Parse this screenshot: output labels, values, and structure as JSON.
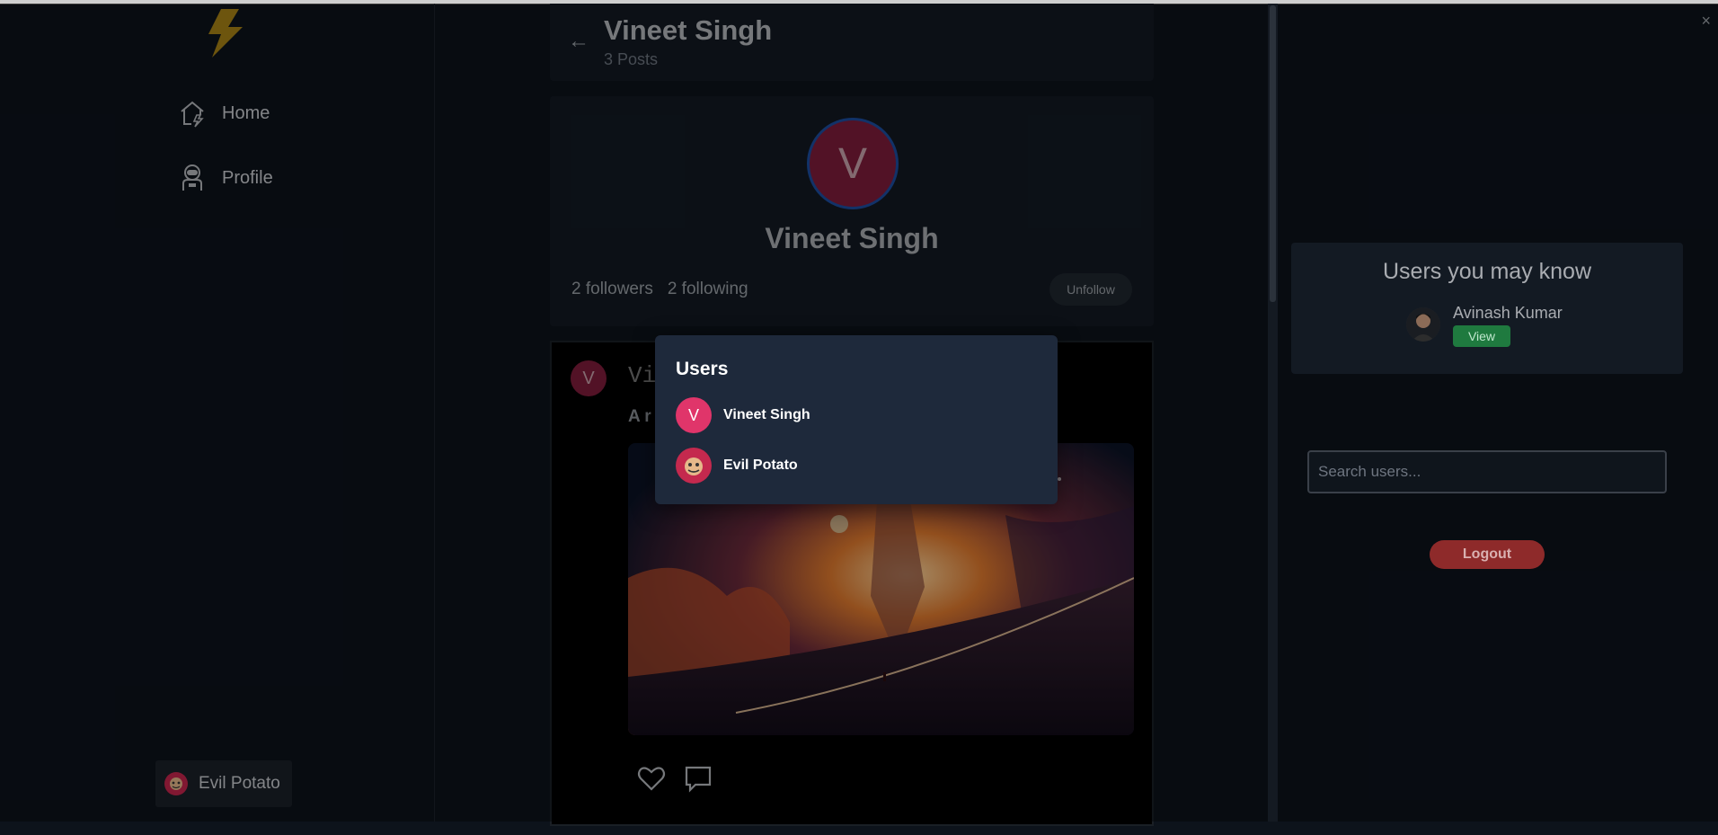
{
  "window": {
    "close_glyph": "×"
  },
  "sidebar": {
    "logo_icon": "lightning-bolt-icon",
    "items": [
      {
        "label": "Home",
        "icon": "home-icon"
      },
      {
        "label": "Profile",
        "icon": "astronaut-icon"
      }
    ],
    "current_user": {
      "name": "Evil Potato"
    }
  },
  "header": {
    "back_glyph": "←",
    "name": "Vineet Singh",
    "posts": "3 Posts"
  },
  "profile": {
    "initial": "V",
    "name": "Vineet Singh",
    "followers": "2 followers",
    "following": "2 following",
    "unfollow_label": "Unfollow"
  },
  "post": {
    "initial": "V",
    "author_partial": "Vi",
    "text_partial": "A r",
    "actions": [
      "heart-icon",
      "comment-icon"
    ]
  },
  "right": {
    "suggest_title": "Users you may know",
    "suggested": [
      {
        "name": "Avinash Kumar",
        "view_label": "View"
      }
    ],
    "search_placeholder": "Search users...",
    "logout_label": "Logout"
  },
  "popup": {
    "title": "Users",
    "users": [
      {
        "name": "Vineet Singh",
        "initial": "V"
      },
      {
        "name": "Evil Potato",
        "initial": ""
      }
    ]
  },
  "colors": {
    "accent_green": "#1f7a3f",
    "logout_red": "#8e2a2a",
    "avatar_pink": "#e0356a",
    "popup_bg": "#1e293b"
  }
}
